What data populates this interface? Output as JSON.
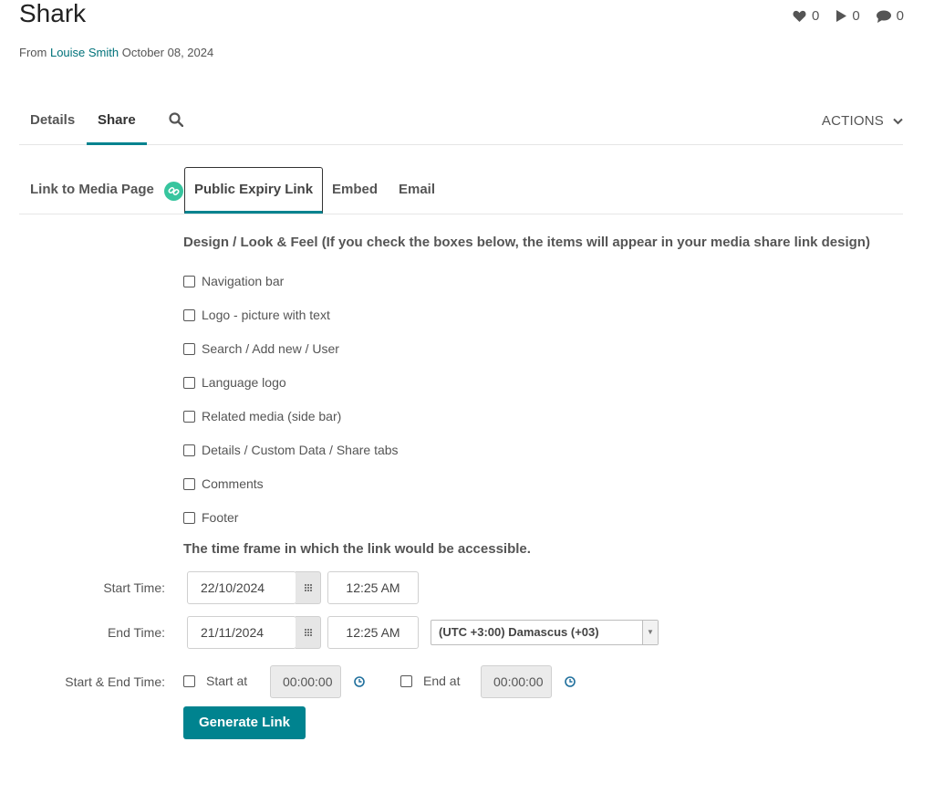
{
  "media": {
    "title": "Shark",
    "from_label": "From",
    "author": "Louise Smith",
    "date": "October 08, 2024"
  },
  "stats": {
    "likes": "0",
    "plays": "0",
    "comments": "0"
  },
  "main_tabs": {
    "details": "Details",
    "share": "Share",
    "actions": "ACTIONS"
  },
  "share_tabs": {
    "link_to_media": "Link to Media Page",
    "public_expiry": "Public Expiry Link",
    "embed": "Embed",
    "email": "Email"
  },
  "design": {
    "heading": "Design / Look & Feel (If you check the boxes below, the items will appear in your media share link design)",
    "options": [
      "Navigation bar",
      "Logo - picture with text",
      "Search / Add new / User",
      "Language logo",
      "Related media (side bar)",
      "Details / Custom Data / Share tabs",
      "Comments",
      "Footer"
    ]
  },
  "timeframe": {
    "heading": "The time frame in which the link would be accessible.",
    "start_label": "Start Time:",
    "start_date": "22/10/2024",
    "start_time": "12:25 AM",
    "end_label": "End Time:",
    "end_date": "21/11/2024",
    "end_time": "12:25 AM",
    "timezone": "(UTC +3:00) Damascus (+03)",
    "start_end_label": "Start & End Time:",
    "start_at_label": "Start at",
    "start_at_value": "00:00:00",
    "end_at_label": "End at",
    "end_at_value": "00:00:00"
  },
  "generate_button": "Generate Link",
  "colors": {
    "accent": "#00838f",
    "link": "#00727a",
    "badge": "#37c59e"
  }
}
